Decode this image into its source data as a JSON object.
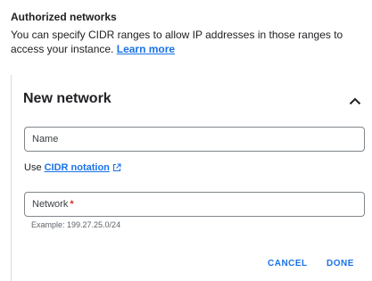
{
  "section": {
    "title": "Authorized networks",
    "description": "You can specify CIDR ranges to allow IP addresses in those ranges to access your instance.",
    "learn_more": "Learn more"
  },
  "card": {
    "title": "New network",
    "collapse_icon": "chevron-up-icon"
  },
  "name_field": {
    "placeholder": "Name",
    "value": ""
  },
  "cidr": {
    "prefix": "Use",
    "link": "CIDR notation",
    "icon": "external-link-icon"
  },
  "network_field": {
    "label": "Network",
    "required_mark": "*",
    "value": "",
    "hint": "Example: 199.27.25.0/24"
  },
  "actions": {
    "cancel": "CANCEL",
    "done": "DONE"
  },
  "colors": {
    "accent": "#1a73e8",
    "required": "#d93025",
    "border": "#80868b"
  }
}
